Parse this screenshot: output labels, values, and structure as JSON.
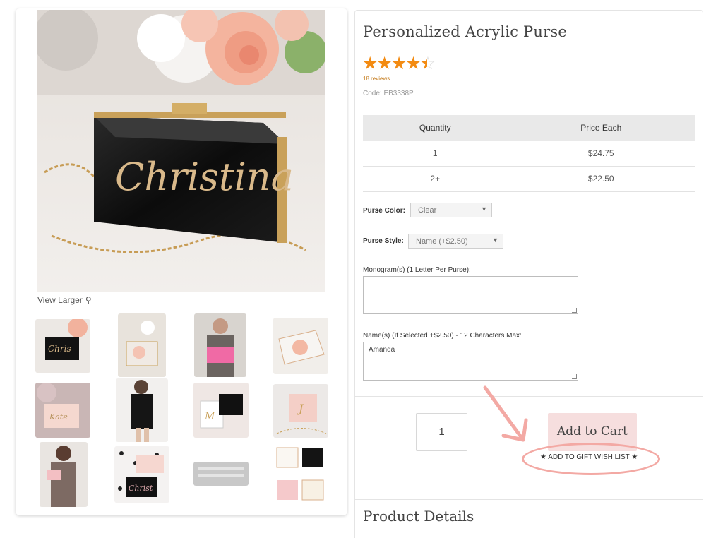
{
  "gallery": {
    "view_larger_label": "View Larger",
    "main_image": "black acrylic purse with gold script name and gold chain on white fur, pink roses behind",
    "thumbnails": [
      "black purse with name on fur",
      "clear purse with flowers",
      "woman holding pink purse",
      "clear purse with flowers angled",
      "pink purse with gold script on blush background",
      "woman in black dress with black purse",
      "white purses with monogram",
      "pink purse with gold monogram",
      "woman in floral dress holding pink purse",
      "white and black purses on dotted background",
      "font style sample strip",
      "color swatch grid"
    ]
  },
  "product": {
    "title": "Personalized Acrylic Purse",
    "rating": 4.5,
    "reviews_label": "18  reviews",
    "code": "Code: EB3338P",
    "price_table": {
      "headers": [
        "Quantity",
        "Price Each"
      ],
      "rows": [
        [
          "1",
          "$24.75"
        ],
        [
          "2+",
          "$22.50"
        ]
      ]
    },
    "purse_color": {
      "label": "Purse Color:",
      "value": "Clear"
    },
    "purse_style": {
      "label": "Purse Style:",
      "value": "Name (+$2.50)"
    },
    "monogram": {
      "label": "Monogram(s) (1 Letter Per Purse):",
      "value": ""
    },
    "name_field": {
      "label": "Name(s) (If Selected +$2.50) - 12 Characters Max:",
      "value": "Amanda"
    },
    "quantity": "1",
    "add_to_cart_label": "Add to Cart",
    "wish_list_label": "★ ADD TO GIFT WISH LIST ★",
    "details_title": "Product Details"
  },
  "colors": {
    "star": "#f38b12",
    "cart_button": "#f6dede",
    "annotation": "#f3a9a4"
  }
}
